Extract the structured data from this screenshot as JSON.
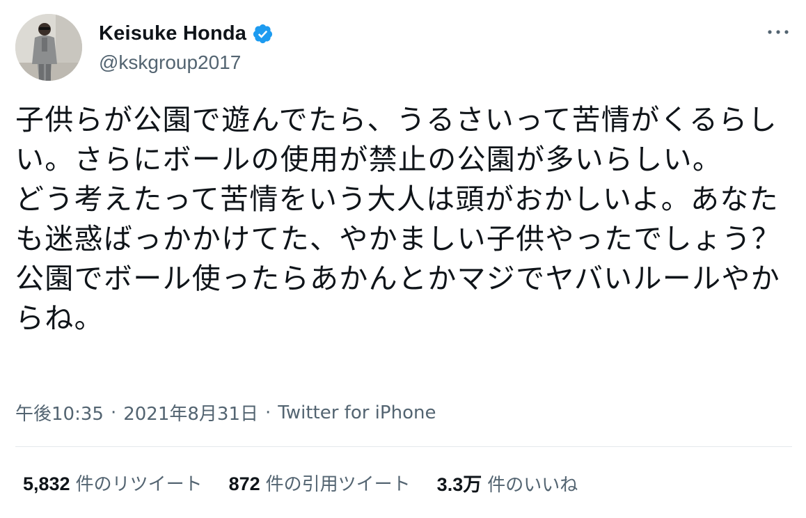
{
  "author": {
    "display_name": "Keisuke Honda",
    "handle": "@kskgroup2017",
    "verified": true,
    "avatar_icon": "profile-photo"
  },
  "tweet": {
    "text": "子供らが公園で遊んでたら、うるさいって苦情がくるらしい。さらにボールの使用が禁止の公園が多いらしい。\nどう考えたって苦情をいう大人は頭がおかしいよ。あなたも迷惑ばっかかけてた、やかましい子供やったでしょう？公園でボール使ったらあかんとかマジでヤバいルールやからね。",
    "time": "午後10:35",
    "date": "2021年8月31日",
    "source": "Twitter for iPhone",
    "separator": "·"
  },
  "stats": {
    "retweets_count": "5,832",
    "retweets_label": "件のリツイート",
    "quotes_count": "872",
    "quotes_label": "件の引用ツイート",
    "likes_count": "3.3万",
    "likes_label": "件のいいね"
  },
  "colors": {
    "text_primary": "#0f1419",
    "text_secondary": "#536471",
    "verified_blue": "#1d9bf0",
    "divider": "#e4e8eb"
  }
}
